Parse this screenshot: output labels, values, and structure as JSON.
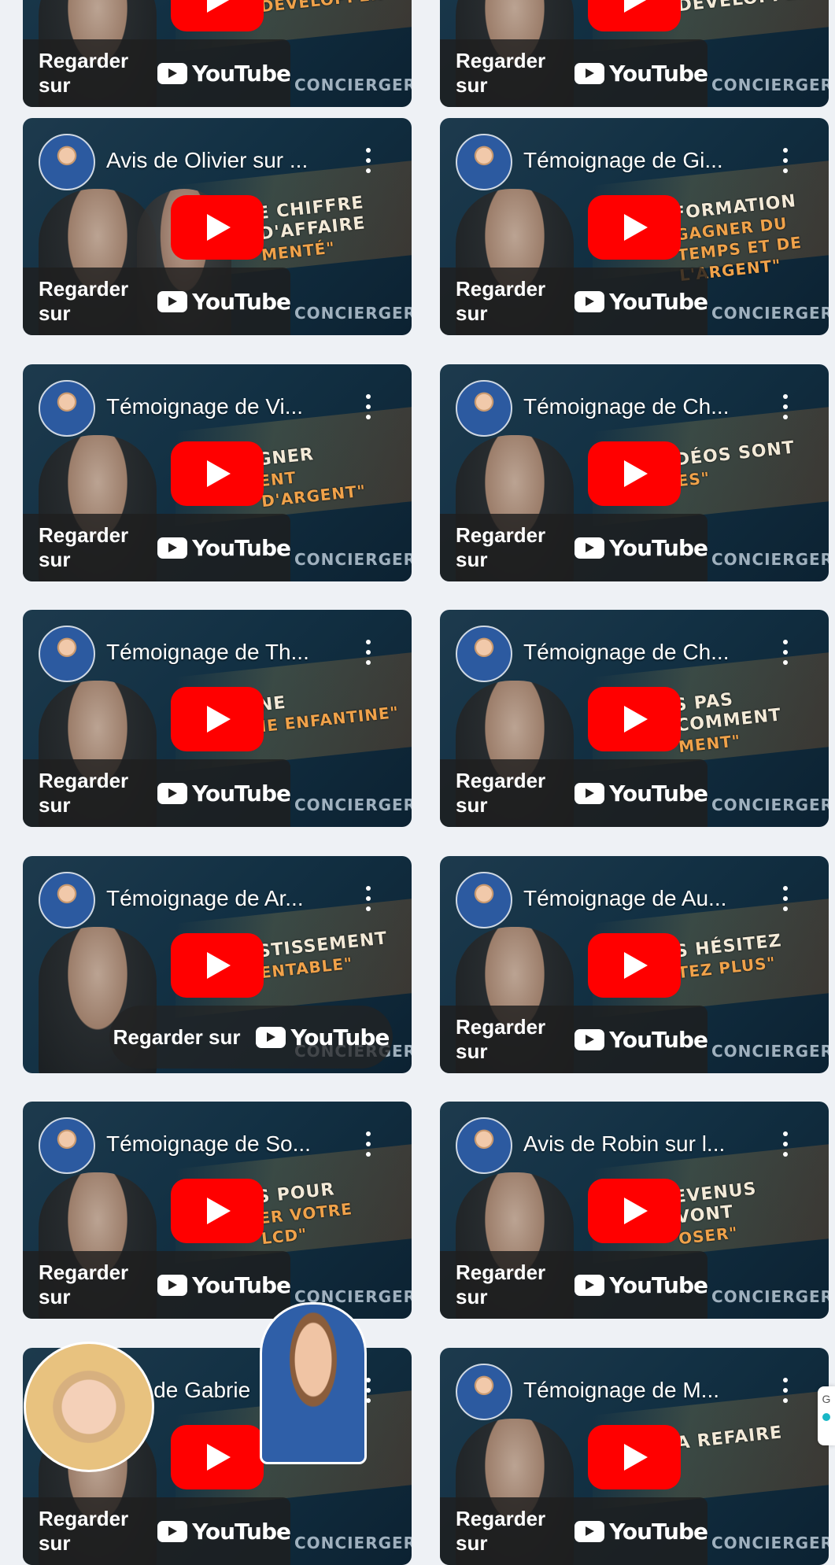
{
  "videos": [
    {
      "title": "",
      "cta": "Regarder sur",
      "overlay": [
        "",
        "LE DÉVELOPPER"
      ]
    },
    {
      "title": "",
      "cta": "Regarder sur",
      "overlay": [
        "LE DÉVELOPPER",
        ""
      ]
    },
    {
      "title": "Avis de Olivier sur ...",
      "cta": "Regarder sur",
      "overlay": [
        "E CHIFFRE D'AFFAIRE",
        "MENTÉ\""
      ]
    },
    {
      "title": "Témoignage de Gi...",
      "cta": "Regarder sur",
      "overlay": [
        "FORMATION",
        "GAGNER DU TEMPS ET DE L'ARGENT\""
      ]
    },
    {
      "title": "Témoignage de Vi...",
      "cta": "Regarder sur",
      "overlay": [
        "GNER",
        "ENT D'ARGENT\""
      ]
    },
    {
      "title": "Témoignage de Ch...",
      "cta": "Regarder sur",
      "overlay": [
        "DÉOS SONT",
        "ES\""
      ]
    },
    {
      "title": "Témoignage de Th...",
      "cta": "Regarder sur",
      "overlay": [
        "NE",
        "IE ENFANTINE\""
      ]
    },
    {
      "title": "Témoignage de Ch...",
      "cta": "Regarder sur",
      "overlay": [
        "S PAS COMMENT",
        "MENT\""
      ]
    },
    {
      "title": "Témoignage de Ar...",
      "cta": "Regarder sur",
      "overlay": [
        "STISSEMENT",
        "ENTABLE\""
      ]
    },
    {
      "title": "Témoignage de Au...",
      "cta": "Regarder sur",
      "overlay": [
        "S HÉSITEZ",
        "TEZ PLUS\""
      ]
    },
    {
      "title": "Témoignage de So...",
      "cta": "Regarder sur",
      "overlay": [
        "S POUR",
        "ER VOTRE LCD\""
      ]
    },
    {
      "title": "Avis de Robin sur l...",
      "cta": "Regarder sur",
      "overlay": [
        "EVENUS VONT",
        "OSER\""
      ]
    },
    {
      "title": "Avis de Gabrie",
      "cta": "Regarder sur",
      "overlay": [
        "",
        ""
      ]
    },
    {
      "title": "Témoignage de M...",
      "cta": "Regarder sur",
      "overlay": [
        "A REFAIRE",
        ""
      ]
    }
  ],
  "youtube_word": "YouTube",
  "brand_mark": "CONCIERGERIE",
  "edge_widget_letter": "G",
  "colors": {
    "play_red": "#ff0000",
    "page_bg": "#eef1f5",
    "accent_teal": "#19b7c6"
  }
}
